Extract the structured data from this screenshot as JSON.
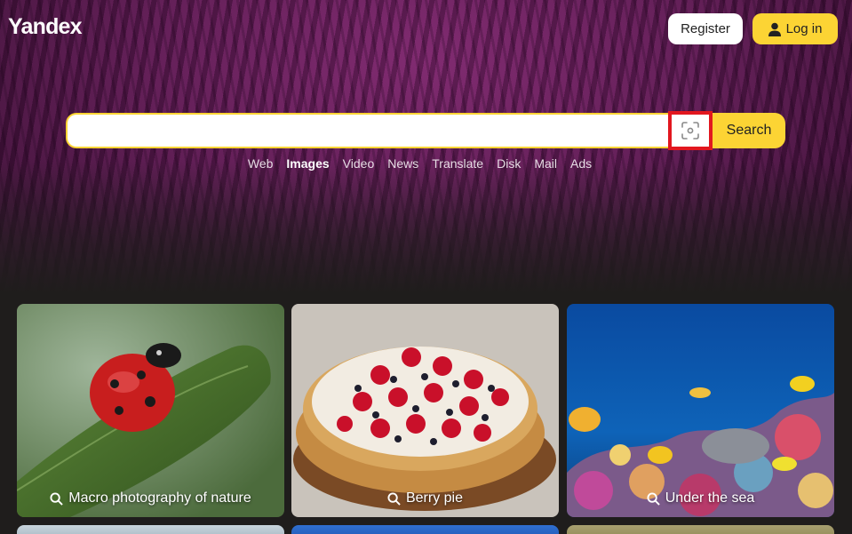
{
  "header": {
    "logo": "Yandex",
    "register_label": "Register",
    "login_label": "Log in"
  },
  "search": {
    "value": "",
    "placeholder": "",
    "camera_icon": "camera-search-icon",
    "button_label": "Search"
  },
  "nav": {
    "items": [
      "Web",
      "Images",
      "Video",
      "News",
      "Translate",
      "Disk",
      "Mail",
      "Ads"
    ],
    "active": "Images"
  },
  "cards": [
    {
      "caption": "Macro photography of nature"
    },
    {
      "caption": "Berry pie"
    },
    {
      "caption": "Under the sea"
    }
  ],
  "colors": {
    "accent": "#fcd434",
    "highlight_border": "#e2171f",
    "background": "#1f1d1c"
  }
}
